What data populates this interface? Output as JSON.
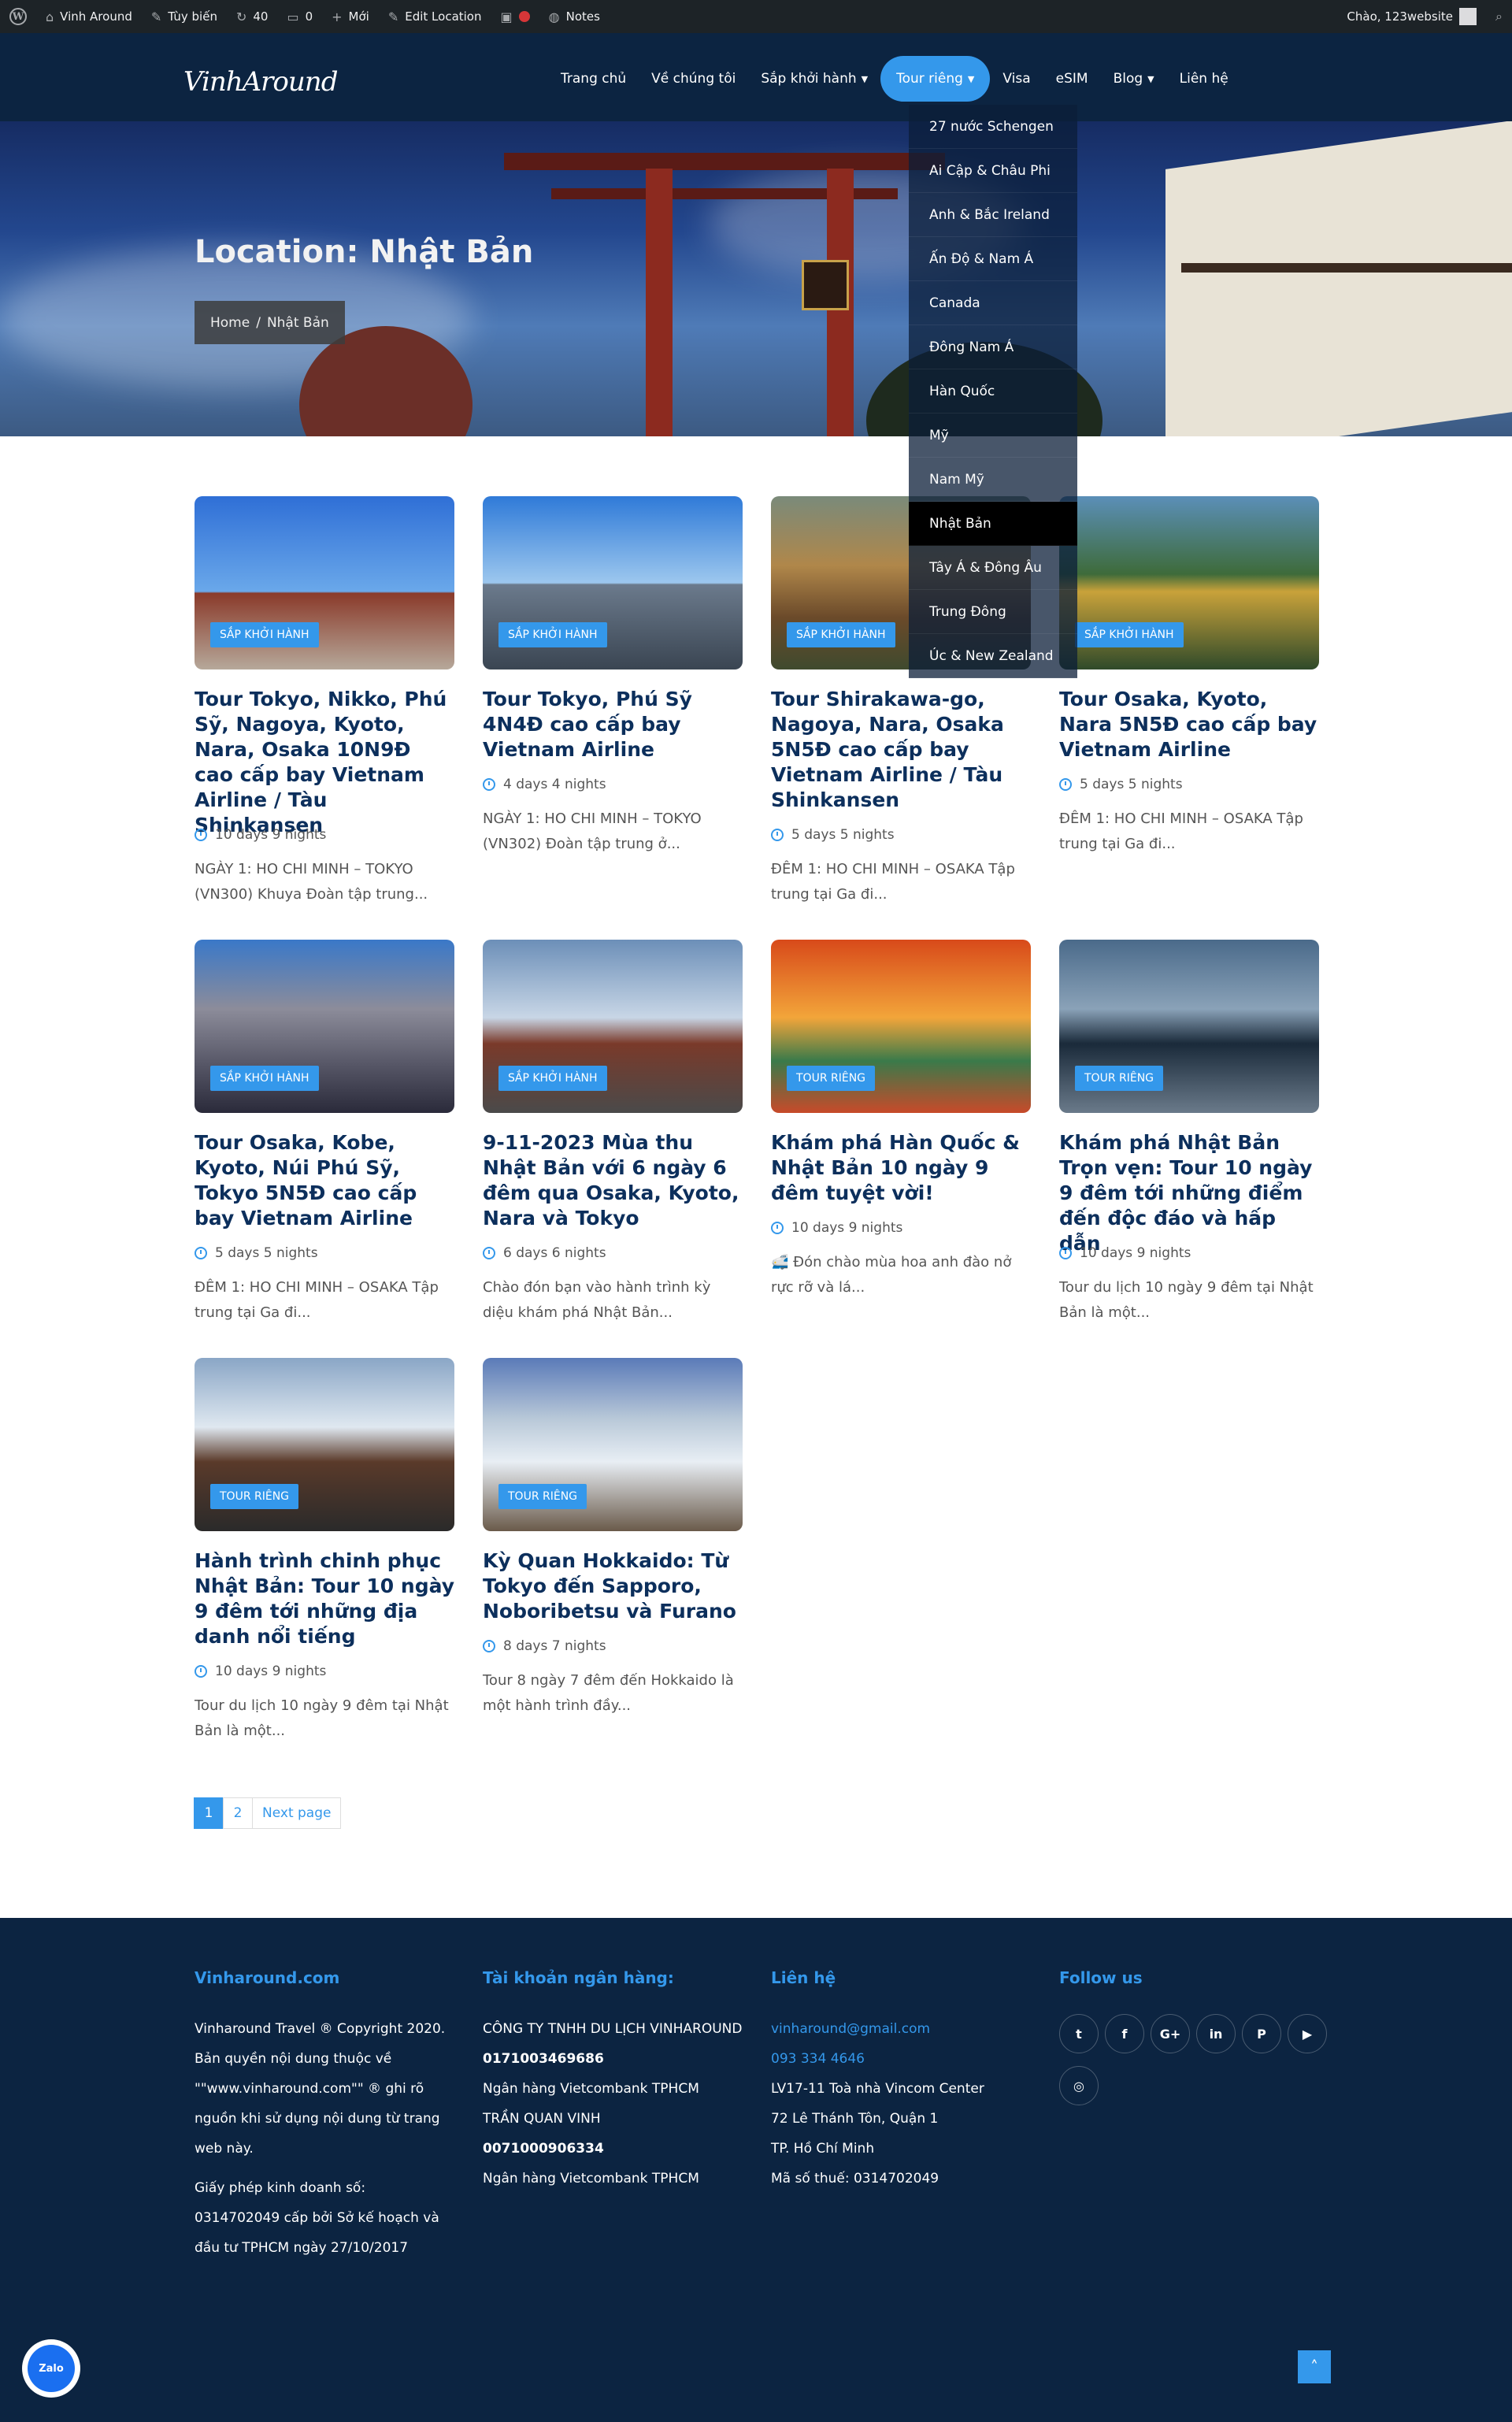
{
  "adminbar": {
    "site_name": "Vinh Around",
    "customize": "Tùy biến",
    "updates": "40",
    "comments": "0",
    "new": "Mới",
    "edit": "Edit Location",
    "notes": "Notes",
    "greeting": "Chào, 123website"
  },
  "header": {
    "logo": "VinhAround",
    "nav": [
      "Trang chủ",
      "Về chúng tôi",
      "Sắp khởi hành",
      "Tour riêng",
      "Visa",
      "eSIM",
      "Blog",
      "Liên hệ"
    ]
  },
  "dropdown": {
    "items": [
      "27 nước Schengen",
      "Ai Cập & Châu Phi",
      "Anh & Bắc Ireland",
      "Ấn Độ & Nam Á",
      "Canada",
      "Đông Nam Á",
      "Hàn Quốc",
      "Mỹ",
      "Nam Mỹ",
      "Nhật Bản",
      "Tây Á & Đông Âu",
      "Trung Đông",
      "Úc & New Zealand"
    ],
    "current_index": 9
  },
  "hero": {
    "title": "Location: Nhật Bản",
    "breadcrumb_home": "Home",
    "breadcrumb_sep": "/",
    "breadcrumb_current": "Nhật Bản"
  },
  "cards": [
    {
      "badge": "SẮP KHỞI HÀNH",
      "title": "Tour Tokyo, Nikko, Phú Sỹ, Nagoya, Kyoto, Nara, Osaka 10N9Đ cao cấp bay Vietnam Airline / Tàu Shinkansen",
      "duration": "10 days 9 nights",
      "excerpt": "NGÀY 1: HO CHI MINH – TOKYO (VN300) Khuya Đoàn tập trung..."
    },
    {
      "badge": "SẮP KHỞI HÀNH",
      "title": "Tour Tokyo, Phú Sỹ 4N4Đ cao cấp bay Vietnam Airline",
      "duration": "4 days 4 nights",
      "excerpt": "NGÀY 1: HO CHI MINH – TOKYO (VN302) Đoàn tập trung ở..."
    },
    {
      "badge": "SẮP KHỞI HÀNH",
      "title": "Tour Shirakawa-go, Nagoya, Nara, Osaka 5N5Đ cao cấp bay Vietnam Airline / Tàu Shinkansen",
      "duration": "5 days 5 nights",
      "excerpt": "ĐÊM 1: HO CHI MINH – OSAKA Tập trung tại Ga đi..."
    },
    {
      "badge": "SẮP KHỞI HÀNH",
      "title": "Tour Osaka, Kyoto, Nara 5N5Đ cao cấp bay Vietnam Airline",
      "duration": "5 days 5 nights",
      "excerpt": "ĐÊM 1: HO CHI MINH – OSAKA Tập trung tại Ga đi..."
    },
    {
      "badge": "SẮP KHỞI HÀNH",
      "title": "Tour Osaka, Kobe, Kyoto, Núi Phú Sỹ, Tokyo 5N5Đ cao cấp bay Vietnam Airline",
      "duration": "5 days 5 nights",
      "excerpt": "ĐÊM 1: HO CHI MINH – OSAKA Tập trung tại Ga đi..."
    },
    {
      "badge": "SẮP KHỞI HÀNH",
      "title": "9-11-2023 Mùa thu Nhật Bản với 6 ngày 6 đêm qua Osaka, Kyoto, Nara và Tokyo",
      "duration": "6 days 6 nights",
      "excerpt": "Chào đón bạn vào hành trình kỳ diệu khám phá Nhật Bản..."
    },
    {
      "badge": "TOUR RIÊNG",
      "title": "Khám phá Hàn Quốc & Nhật Bản 10 ngày 9 đêm tuyệt vời!",
      "duration": "10 days 9 nights",
      "excerpt": "🚅 Đón chào mùa hoa anh đào nở rực rỡ và lá..."
    },
    {
      "badge": "TOUR RIÊNG",
      "title": "Khám phá Nhật Bản Trọn vẹn: Tour 10 ngày 9 đêm tới những điểm đến độc đáo và hấp dẫn",
      "duration": "10 days 9 nights",
      "excerpt": "Tour du lịch 10 ngày 9 đêm tại Nhật Bản là một..."
    },
    {
      "badge": "TOUR RIÊNG",
      "title": "Hành trình chinh phục Nhật Bản: Tour 10 ngày 9 đêm tới những địa danh nổi tiếng",
      "duration": "10 days 9 nights",
      "excerpt": "Tour du lịch 10 ngày 9 đêm tại Nhật Bản là một..."
    },
    {
      "badge": "TOUR RIÊNG",
      "title": "Kỳ Quan Hokkaido: Từ Tokyo đến Sapporo, Noboribetsu và Furano",
      "duration": "8 days 7 nights",
      "excerpt": "Tour 8 ngày 7 đêm đến Hokkaido là một hành trình đầy..."
    }
  ],
  "pagination": {
    "pages": [
      "1",
      "2"
    ],
    "next": "Next page"
  },
  "footer": {
    "col1_title": "Vinharound.com",
    "col1_text": "Vinharound Travel ® Copyright 2020. Bản quyền nội dung thuộc về \"\"www.vinharound.com\"\" ® ghi rõ nguồn khi sử dụng nội dung từ trang web này.",
    "col1_license": "Giấy phép kinh doanh số: 0314702049 cấp bởi Sở kế hoạch và đầu tư TPHCM ngày 27/10/2017",
    "col2_title": "Tài khoản ngân hàng:",
    "company": "CÔNG TY TNHH DU LỊCH VINHAROUND",
    "account1": "0171003469686",
    "bank1": "Ngân hàng Vietcombank TPHCM",
    "holder2": "TRẦN QUAN VINH",
    "account2": "0071000906334",
    "bank2": "Ngân hàng Vietcombank TPHCM",
    "col3_title": "Liên hệ",
    "email": "vinharound@gmail.com",
    "phone": "093 334 4646",
    "address1": "LV17-11 Toà nhà Vincom Center",
    "address2": "72 Lê Thánh Tôn, Quận 1",
    "address3": "TP. Hồ Chí Minh",
    "tax": "Mã số thuế: 0314702049",
    "col4_title": "Follow us",
    "socials": [
      "twitter-icon",
      "facebook-icon",
      "google-plus-icon",
      "linkedin-icon",
      "pinterest-icon",
      "youtube-icon",
      "instagram-icon"
    ],
    "zalo": "Zalo"
  },
  "colors": {
    "accent": "#3498eb",
    "navy": "#0c2441",
    "title": "#0c2f5c"
  }
}
